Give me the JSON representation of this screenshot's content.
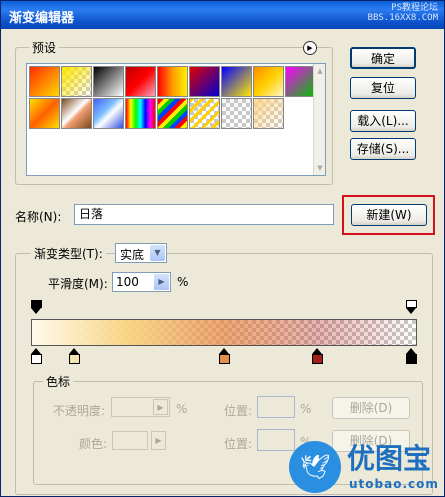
{
  "window": {
    "title": "渐变编辑器",
    "watermark_line1": "PS教程论坛",
    "watermark_line2": "BBS.16XX8.COM"
  },
  "buttons": {
    "ok": "确定",
    "reset": "复位",
    "load": "载入(L)...",
    "save": "存储(S)...",
    "new": "新建(W)"
  },
  "presets": {
    "legend": "预设",
    "menu_icon": "circle-arrow-right-icon",
    "swatches": [
      {
        "bg": "linear-gradient(135deg,#ff2a00,#ffd800)"
      },
      {
        "bg": "linear-gradient(135deg,#ffe600,rgba(255,230,0,0))",
        "checker": true
      },
      {
        "bg": "linear-gradient(135deg,#000000,#ffffff)"
      },
      {
        "bg": "linear-gradient(135deg,#c00000,#ff0000,#f7a3c0)"
      },
      {
        "bg": "linear-gradient(to right,#ff0000,#ff9a00,#fff200)"
      },
      {
        "bg": "linear-gradient(135deg,#e00000,#0000d0)"
      },
      {
        "bg": "linear-gradient(135deg,#0000ff,#ffea00)"
      },
      {
        "bg": "linear-gradient(135deg,#ff8c00,#ffd000,#fff6c0)"
      },
      {
        "bg": "linear-gradient(135deg,#ff00ff,#00c000)"
      },
      {
        "bg": "linear-gradient(135deg,#ffe000,#ff6000 50%,#ffe000)"
      },
      {
        "bg": "linear-gradient(135deg,#7a4a20,#ffffff 45%,#f0a070 55%,#7a4a20)"
      },
      {
        "bg": "linear-gradient(135deg,#4060ff,#80c0ff 40%,#ffffff 55%,#3050e0)"
      },
      {
        "bg": "linear-gradient(to right,#ff0000,#ffff00,#00ff00,#00ffff,#0000ff,#ff00ff,#ff0000)"
      },
      {
        "bg": "repeating-linear-gradient(135deg,#ff0000 0 4px,#ffee00 4px 8px,#00cc00 8px 12px,#0040ff 12px 16px)"
      },
      {
        "bg": "repeating-linear-gradient(135deg,#ffd000 0 3px,rgba(255,208,0,0) 3px 7px)",
        "checker": true
      },
      {
        "bg": "linear-gradient(135deg,rgba(200,200,200,0.2),rgba(200,200,200,0))",
        "checker": true
      },
      {
        "bg": "linear-gradient(135deg,rgba(255,210,130,0.9),rgba(255,170,120,0))",
        "checker": true
      }
    ]
  },
  "name": {
    "label": "名称(N):",
    "value": "日落"
  },
  "gradient": {
    "type_label": "渐变类型(T):",
    "type_value": "实底",
    "smoothness_label": "平滑度(M):",
    "smoothness_value": "100",
    "smoothness_unit": "%",
    "opacity_stops": [
      0,
      1
    ],
    "color_stops": [
      {
        "position": 0.0,
        "color": "#ffffff"
      },
      {
        "position": 0.1,
        "color": "#f2e4b0"
      },
      {
        "position": 0.5,
        "color": "#e0904a"
      },
      {
        "position": 0.75,
        "color": "#a02018"
      },
      {
        "position": 1.0,
        "color": "#000000"
      }
    ]
  },
  "stops": {
    "legend": "色标",
    "opacity_label": "不透明度:",
    "opacity_unit": "%",
    "color_label": "颜色:",
    "location_label_1": "位置:",
    "location_label_2": "位置:",
    "location_unit_1": "%",
    "location_unit_2": "%",
    "delete_1": "删除(D)",
    "delete_2": "删除(D)"
  },
  "logo": {
    "brand": "优图宝",
    "domain": "utobao.com",
    "bird_icon": "bird-icon"
  },
  "colors": {
    "title_bar": "#0a5fd8",
    "highlight": "#d8101a"
  }
}
